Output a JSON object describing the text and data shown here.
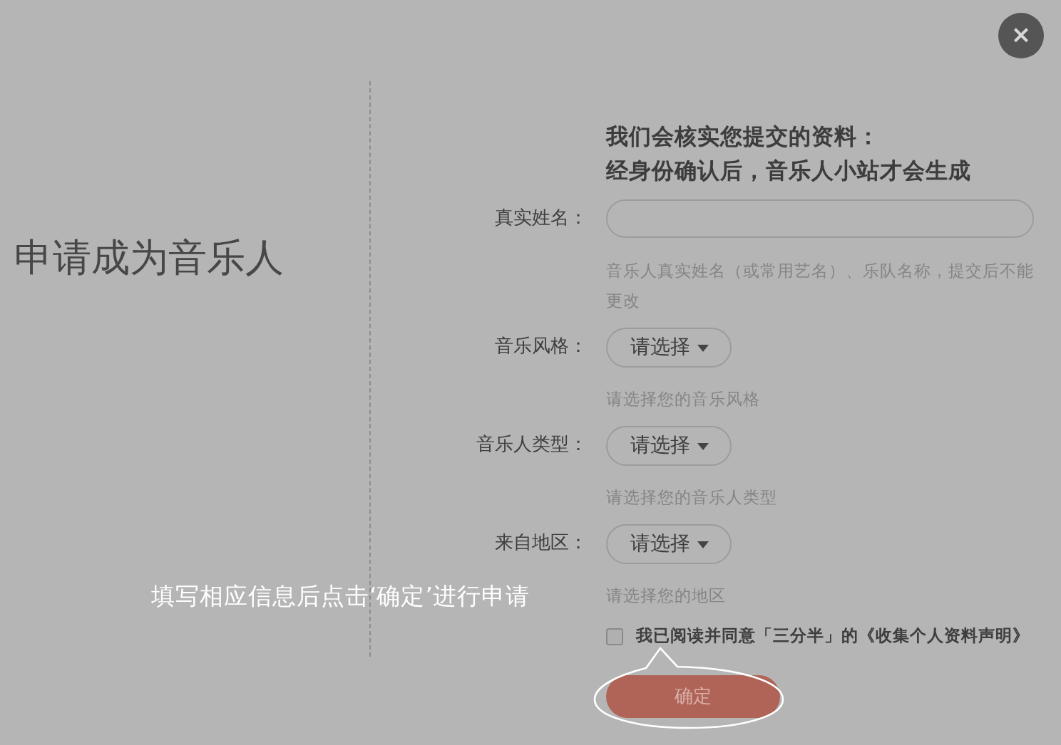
{
  "close": "×",
  "title": "申请成为音乐人",
  "heading": [
    "我们会核实您提交的资料：",
    "经身份确认后，音乐人小站才会生成"
  ],
  "fields": [
    {
      "kind": "text",
      "label": "真实姓名：",
      "hint": "音乐人真实姓名（或常用艺名）、乐队名称，提交后不能更改"
    },
    {
      "kind": "select",
      "label": "音乐风格：",
      "button": "请选择",
      "hint": "请选择您的音乐风格"
    },
    {
      "kind": "select",
      "label": "音乐人类型：",
      "button": "请选择",
      "hint": "请选择您的音乐人类型"
    },
    {
      "kind": "select",
      "label": "来自地区：",
      "button": "请选择",
      "hint": "请选择您的地区"
    }
  ],
  "agreement": {
    "checked": false,
    "text": "我已阅读并同意「三分半」的《收集个人资料声明》"
  },
  "submit": "确定",
  "annotation": "填写相应信息后点击‘确定’进行申请"
}
